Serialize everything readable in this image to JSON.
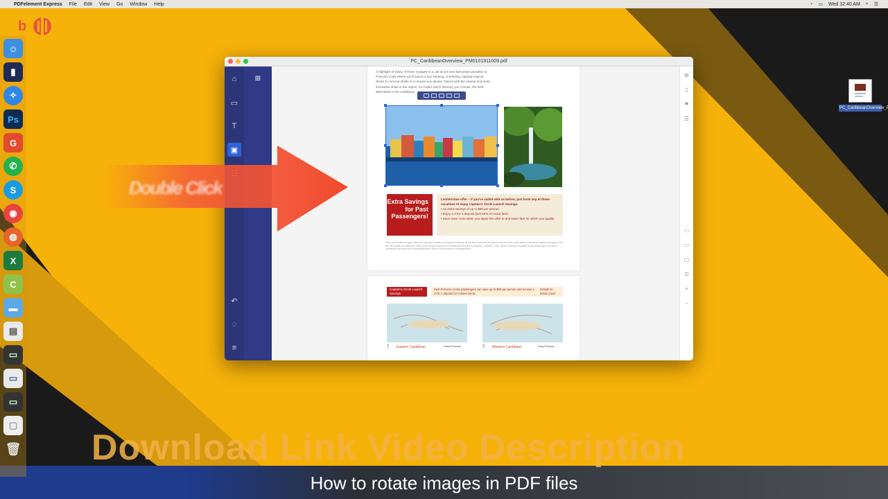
{
  "menubar": {
    "app_name": "PDFelement Express",
    "menus": [
      "File",
      "Edit",
      "View",
      "Go",
      "Window",
      "Help"
    ],
    "clock": "Wed 12:40 AM"
  },
  "logo": {
    "letter": "b"
  },
  "dock": {
    "apps": [
      {
        "name": "finder",
        "color": "#3d8fe0",
        "glyph": "☺"
      },
      {
        "name": "flipboard",
        "color": "#1d2b55",
        "glyph": "▮"
      },
      {
        "name": "safari",
        "color": "#2f86e6",
        "glyph": "✧"
      },
      {
        "name": "photoshop",
        "color": "#0f2b52",
        "glyph": "Ps"
      },
      {
        "name": "app-g",
        "color": "#e24b2e",
        "glyph": "G"
      },
      {
        "name": "whatsapp",
        "color": "#22b14c",
        "glyph": "✆"
      },
      {
        "name": "skype",
        "color": "#1a9de0",
        "glyph": "S"
      },
      {
        "name": "chrome",
        "color": "#e8453c",
        "glyph": "◉"
      },
      {
        "name": "firefox",
        "color": "#e8642a",
        "glyph": "◍"
      },
      {
        "name": "excel",
        "color": "#1d7a3e",
        "glyph": "X"
      },
      {
        "name": "app-c",
        "color": "#8fc24a",
        "glyph": "C"
      }
    ]
  },
  "desktop_file": {
    "label": "PC_CaribbeanOverview_PM...1009.pdf"
  },
  "window": {
    "title": "PC_CaribbeanOverview_PM0101911009.pdf",
    "sidebar_icons": [
      "home-icon",
      "comment-icon",
      "text-icon",
      "image-icon",
      "form-icon"
    ],
    "document": {
      "intro_paragraph": "A highlight of many of these voyages is a call at our own Bahamian paradise at Princess Cays where you'll spend a day sunning, snorkeling, sipping tropical drinks in coconut shells or in leisure you please. Paired with the natural and more innovative ships in the region, no matter which itinerary you choose, the best alternative in the Caribbean.",
      "offer_red": "Extra Savings for Past Passengers!",
      "offer_heading": "Limited-time offer – If you've sailed with us before, just book any of these vacations to enjoy Captain's Circle Launch Savings.",
      "offer_items": [
        "• An extra savings of up to $50 per person",
        "• Enjoy a 2-for-1 deposit (just 50% of cruise fare)",
        "• Save even more when you apply this offer to and lower fare for which you qualify"
      ],
      "fine_print": "Terms and conditions apply. Offers are capacity controlled and may be withdrawn at any time. Fares are per person, non-air, cruise-only, based on double occupancy and apply to the first two guests in a stateroom. Taxes, fees and port expenses are additional and apply to all guests. Captain's Circle Launch Savings is available to past passengers only and is combinable with most other promotional fares. Refer to the brochure for complete terms.",
      "page2_tag": "Captain's Circle Launch Savings",
      "page2_text": "Past Princess cruise passengers can save up to $50 per person and receive a 2-for-1 deposit for cruises below.",
      "page2_link": "Details on inside cover.",
      "maps": [
        {
          "title": "Eastern Caribbean",
          "days": "7",
          "ship": "Grand Princess"
        },
        {
          "title": "Western Caribbean",
          "days": "7",
          "ship": "Ruby Princess"
        }
      ]
    }
  },
  "arrow_text": "Double Click",
  "watermark": "Download Link Video Description",
  "caption": "How to rotate images in PDF files"
}
